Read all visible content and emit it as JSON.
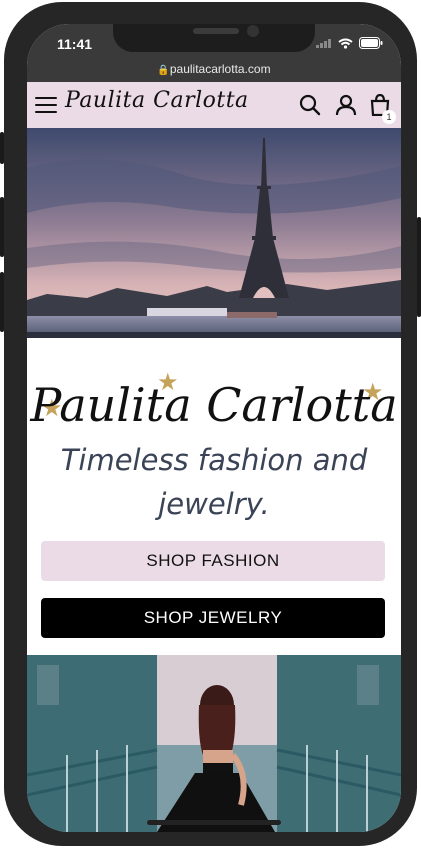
{
  "status": {
    "time": "11:41"
  },
  "browser": {
    "url": "paulitacarlotta.com"
  },
  "header": {
    "brand": "Paulita Carlotta",
    "cart_count": "1"
  },
  "hero": {
    "brand": "Paulita Carlotta",
    "tagline": "Timeless fashion and jewelry."
  },
  "buttons": {
    "shop_fashion": "SHOP FASHION",
    "shop_jewelry": "SHOP JEWELRY"
  },
  "colors": {
    "header_bg": "#ebdbe6",
    "accent_gold": "#c5a35a",
    "tagline": "#3b4357"
  }
}
